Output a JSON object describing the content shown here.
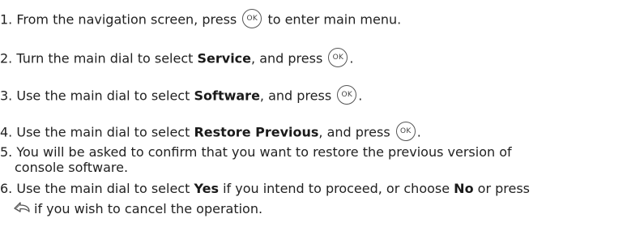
{
  "steps": [
    {
      "num": "1.",
      "before": "From the navigation screen, press",
      "icon": "ok-button-icon",
      "icon_text": "OK",
      "after": "to enter main menu."
    },
    {
      "num": "2.",
      "before": "Turn the main dial to select",
      "bold": "Service",
      "mid": ", and press",
      "icon_text": "OK",
      "after": "."
    },
    {
      "num": "3.",
      "before": "Use the main dial to select",
      "bold": "Software",
      "mid": ", and press",
      "icon_text": "OK",
      "after": "."
    },
    {
      "num": "4.",
      "before": "Use the main dial to select",
      "bold": "Restore Previous",
      "mid": ", and press",
      "icon_text": "OK",
      "after": "."
    },
    {
      "num": "5.",
      "line1": "You will be asked to confirm that you want to restore the previous version of",
      "line2": "console software."
    },
    {
      "num": "6.",
      "before": "Use the main dial to select",
      "bold1": "Yes",
      "mid1": "if you intend to proceed, or choose",
      "bold2": "No",
      "mid2": "or press",
      "icon": "back-button-icon",
      "after": "if you wish to cancel the operation."
    }
  ]
}
